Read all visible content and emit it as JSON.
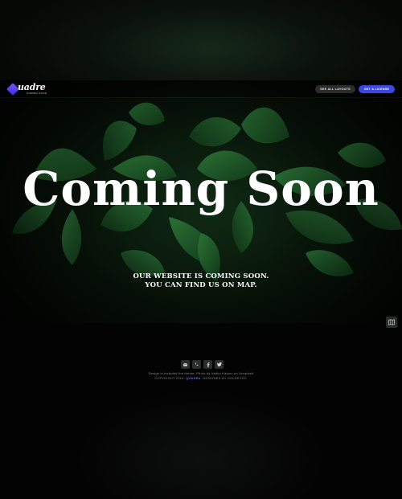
{
  "navbar": {
    "logo_text": "uadre",
    "logo_sub": "COMING SOON",
    "see_layouts_label": "SEE ALL LAYOUTS",
    "license_label": "GET A LICENSE"
  },
  "hero": {
    "title": "Coming Soon",
    "subtitle_line1": "OUR WEBSITE IS COMING SOON.",
    "subtitle_line2": "YOU CAN FIND US ON MAP."
  },
  "footer": {
    "social": [
      {
        "icon": "envelope-icon"
      },
      {
        "icon": "phone-icon"
      },
      {
        "icon": "facebook-icon"
      },
      {
        "icon": "twitter-icon"
      }
    ],
    "credit": "Design is included the theme. Photo by Vadim Kaipov on Unsplash",
    "copyright_prefix": "COPYRIGHT 2019.",
    "copyright_brand": "QUADRA",
    "copyright_suffix": ". DESIGNED BY GOLDEYES."
  },
  "colors": {
    "accent": "#3c46e0",
    "background": "#050605",
    "leaf": "#1f5a2a"
  }
}
